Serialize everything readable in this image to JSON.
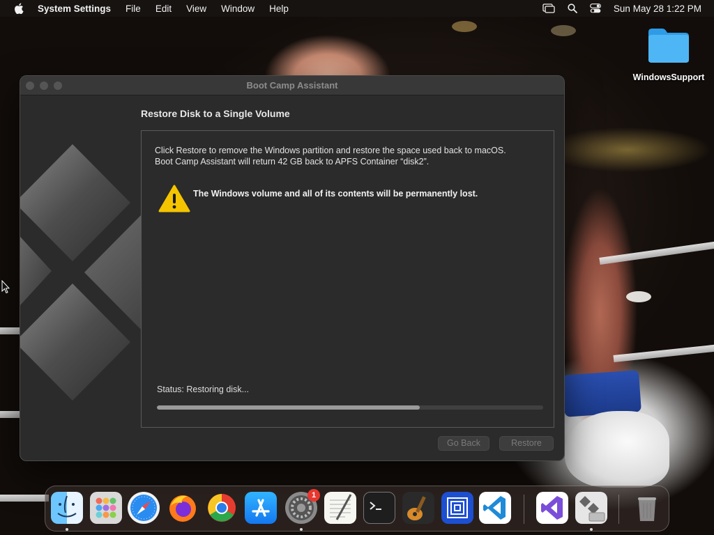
{
  "menubar": {
    "app_name": "System Settings",
    "menus": [
      "File",
      "Edit",
      "View",
      "Window",
      "Help"
    ],
    "clock": "Sun May 28  1:22 PM"
  },
  "desktop": {
    "folder_label": "WindowsSupport"
  },
  "window": {
    "title": "Boot Camp Assistant",
    "heading": "Restore Disk to a Single Volume",
    "description_line1": "Click Restore to remove the Windows partition and restore the space used back to macOS.",
    "description_line2": "Boot Camp Assistant will return 42 GB back to APFS Container “disk2”.",
    "warning": "The Windows volume and all of its contents will be permanently lost.",
    "status": "Status: Restoring disk...",
    "progress": 0.68,
    "buttons": {
      "go_back": "Go Back",
      "restore": "Restore"
    }
  },
  "dock": {
    "items": [
      "Finder",
      "Launchpad",
      "Safari",
      "Firefox",
      "Chrome",
      "App Store",
      "System Settings",
      "TextEdit",
      "Terminal",
      "GarageBand",
      "Remote Desktop",
      "Visual Studio Code",
      "Visual Studio",
      "Boot Camp Assistant",
      "Trash"
    ],
    "settings_badge": "1"
  },
  "colors": {
    "warning_yellow": "#f5c400",
    "window_bg": "#2b2b2b"
  }
}
